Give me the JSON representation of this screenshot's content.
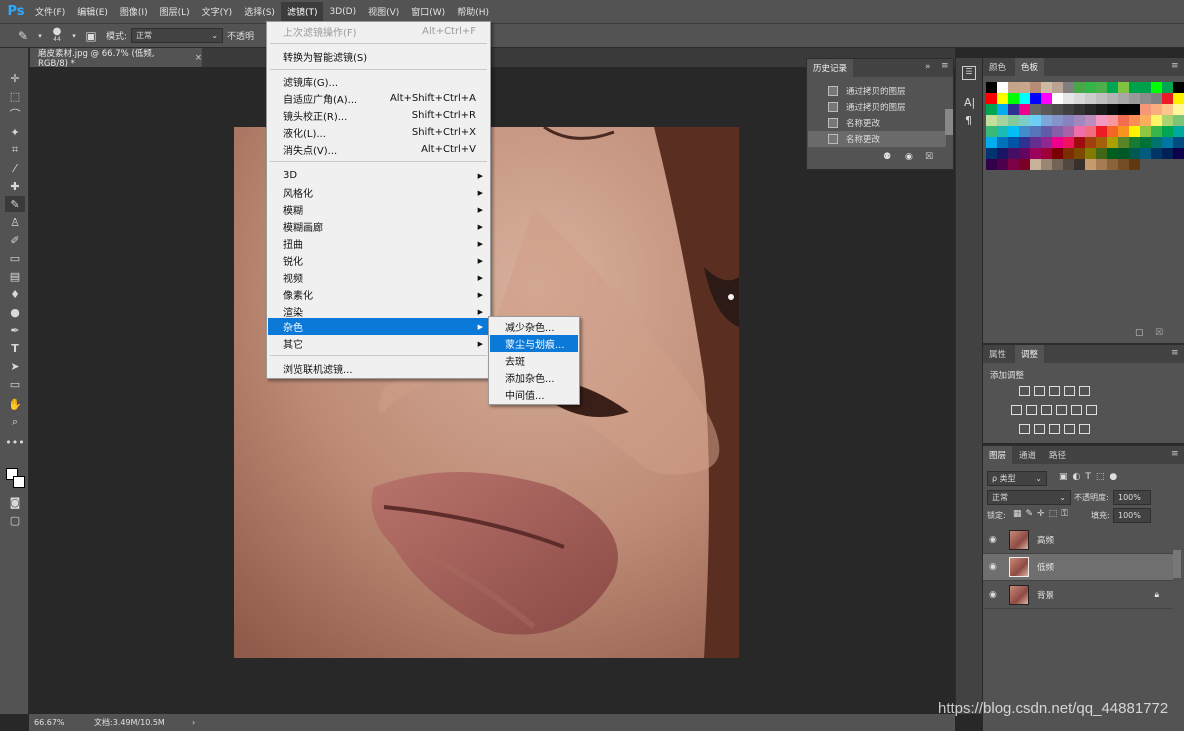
{
  "app": {
    "logo": "Ps"
  },
  "menubar": {
    "items": [
      "文件(F)",
      "编辑(E)",
      "图像(I)",
      "图层(L)",
      "文字(Y)",
      "选择(S)",
      "滤镜(T)",
      "3D(D)",
      "视图(V)",
      "窗口(W)",
      "帮助(H)"
    ],
    "active_index": 6
  },
  "options": {
    "brush_size": "44",
    "mode_label": "模式:",
    "mode_value": "正常",
    "opacity_label": "不透明"
  },
  "document_tab": {
    "title": "磨皮素材.jpg @ 66.7% (低频, RGB/8) *",
    "close": "×"
  },
  "filter_menu": {
    "items": [
      {
        "label": "上次滤镜操作(F)",
        "shortcut": "Alt+Ctrl+F",
        "disabled": true
      },
      {
        "label": "转换为智能滤镜(S)",
        "shortcut": ""
      },
      {
        "label": "滤镜库(G)...",
        "shortcut": ""
      },
      {
        "label": "自适应广角(A)...",
        "shortcut": "Alt+Shift+Ctrl+A"
      },
      {
        "label": "镜头校正(R)...",
        "shortcut": "Shift+Ctrl+R"
      },
      {
        "label": "液化(L)...",
        "shortcut": "Shift+Ctrl+X"
      },
      {
        "label": "消失点(V)...",
        "shortcut": "Alt+Ctrl+V"
      },
      {
        "label": "3D"
      },
      {
        "label": "风格化"
      },
      {
        "label": "模糊"
      },
      {
        "label": "模糊画廊"
      },
      {
        "label": "扭曲"
      },
      {
        "label": "锐化"
      },
      {
        "label": "视频"
      },
      {
        "label": "像素化"
      },
      {
        "label": "渲染"
      },
      {
        "label": "杂色"
      },
      {
        "label": "其它"
      },
      {
        "label": "浏览联机滤镜..."
      }
    ]
  },
  "noise_submenu": {
    "items": [
      "减少杂色...",
      "蒙尘与划痕...",
      "去斑",
      "添加杂色...",
      "中间值..."
    ],
    "highlighted_index": 1
  },
  "history_panel": {
    "tab": "历史记录",
    "rows": [
      "通过拷贝的图层",
      "通过拷贝的图层",
      "名称更改",
      "名称更改"
    ],
    "selected_index": 3
  },
  "swatches_panel": {
    "tabs": [
      "颜色",
      "色板"
    ],
    "active_tab": 1,
    "colors": [
      "#000000",
      "#ffffff",
      "#c4a589",
      "#c8a88c",
      "#b78e75",
      "#cdbaa3",
      "#bba393",
      "#7f7f7f",
      "#48a748",
      "#33b54a",
      "#4cb04a",
      "#00a651",
      "#81c341",
      "#00a14b",
      "#00a14b",
      "#00ff00",
      "#00a651",
      "#000000",
      "#ff0000",
      "#ffff00",
      "#00ff00",
      "#00ffff",
      "#0000ff",
      "#ff00ff",
      "#ffffff",
      "#e6e6e6",
      "#d9d9d9",
      "#cccccc",
      "#bfbfbf",
      "#b3b3b3",
      "#a6a6a6",
      "#999999",
      "#8c8c8c",
      "#808080",
      "#ed1c24",
      "#fff200",
      "#00a651",
      "#00aeef",
      "#2e3192",
      "#ec008c",
      "#666666",
      "#595959",
      "#4d4d4d",
      "#404040",
      "#333333",
      "#262626",
      "#1a1a1a",
      "#0d0d0d",
      "#000000",
      "#010101",
      "#f7977a",
      "#f9ad81",
      "#fdc68a",
      "#fff79a",
      "#c4df9b",
      "#a2d39c",
      "#82ca9d",
      "#7bcdc8",
      "#6ecff6",
      "#7ea7d8",
      "#8493ca",
      "#8882be",
      "#a187be",
      "#bc8dbf",
      "#f49ac2",
      "#f6989d",
      "#f26c4f",
      "#f68e55",
      "#fbaf5c",
      "#fff467",
      "#acd372",
      "#7cc576",
      "#3bb878",
      "#1abbb4",
      "#00bff3",
      "#438ccb",
      "#5574b9",
      "#605ca8",
      "#855fa8",
      "#a763a8",
      "#f06eaa",
      "#f26d7d",
      "#ed1c24",
      "#f26522",
      "#f7941d",
      "#fff200",
      "#8dc73f",
      "#39b54a",
      "#00a651",
      "#00a99d",
      "#00aeef",
      "#0072bc",
      "#0054a6",
      "#2e3192",
      "#662d91",
      "#92278f",
      "#ec008c",
      "#ed145b",
      "#9e0b0f",
      "#a0410d",
      "#a3620a",
      "#aba000",
      "#598527",
      "#197b30",
      "#007236",
      "#00746b",
      "#0076a3",
      "#004b80",
      "#003471",
      "#1b1464",
      "#440e62",
      "#630460",
      "#9e005d",
      "#9e0039",
      "#790000",
      "#7b2e00",
      "#7d4900",
      "#827b00",
      "#406618",
      "#005e20",
      "#005826",
      "#005952",
      "#005b7f",
      "#003663",
      "#002157",
      "#0d004c",
      "#32004b",
      "#4b0049",
      "#7b0046",
      "#7a0026",
      "#c7b299",
      "#998675",
      "#736357",
      "#534741",
      "#37302d",
      "#c69c6d",
      "#a67c52",
      "#8c6239",
      "#754c24",
      "#603913"
    ]
  },
  "adjust_panel": {
    "tabs": [
      "属性",
      "调整"
    ],
    "active_tab": 1,
    "title": "添加调整"
  },
  "layers_panel": {
    "tabs": [
      "图层",
      "通道",
      "路径"
    ],
    "active_tab": 0,
    "kind_label": "ρ 类型",
    "blend_mode": "正常",
    "opacity_label": "不透明度:",
    "opacity_value": "100%",
    "lock_label": "锁定:",
    "fill_label": "填充:",
    "fill_value": "100%",
    "layers": [
      "高频",
      "低频",
      "背景"
    ],
    "selected_index": 1
  },
  "statusbar": {
    "zoom": "66.67%",
    "doc_info": "文档:3.49M/10.5M",
    "arrow": "›"
  },
  "watermark": "https://blog.csdn.net/qq_44881772"
}
